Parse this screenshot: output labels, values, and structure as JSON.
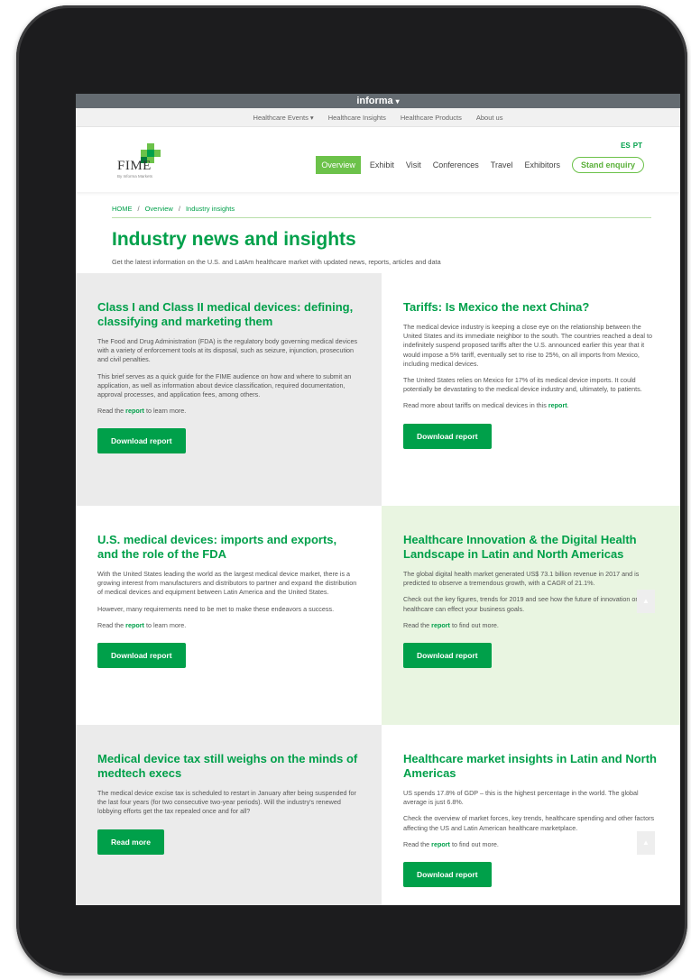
{
  "informa": {
    "label": "informa",
    "caret": "▾"
  },
  "top_nav": [
    "Healthcare Events ▾",
    "Healthcare Insights",
    "Healthcare Products",
    "About us"
  ],
  "logo": {
    "name": "FIME",
    "tagline": "By Informa Markets"
  },
  "lang": [
    "ES",
    "PT"
  ],
  "main_nav": {
    "items": [
      "Overview",
      "Exhibit",
      "Visit",
      "Conferences",
      "Travel",
      "Exhibitors"
    ],
    "enquiry": "Stand enquiry"
  },
  "breadcrumb": [
    "HOME",
    "Overview",
    "Industry insights"
  ],
  "breadcrumb_sep": "/",
  "page": {
    "title": "Industry news and insights",
    "subtitle": "Get the latest information on the U.S. and LatAm healthcare market with updated news, reports, articles and data"
  },
  "cards": [
    {
      "title": "Class I and Class II medical devices: defining, classifying and marketing them",
      "paragraphs": [
        "The Food and Drug Administration (FDA) is the regulatory body governing medical devices with a variety of enforcement tools at its disposal, such as seizure, injunction, prosecution and civil penalties.",
        "This brief serves as a quick guide for the FIME audience on how and where to submit an application, as well as information about device classification, required documentation, approval processes, and application fees, among others."
      ],
      "read_pre": "Read the ",
      "read_link": "report",
      "read_post": " to learn more.",
      "button": "Download report"
    },
    {
      "title": "Tariffs: Is Mexico the next China?",
      "paragraphs": [
        "The medical device industry is keeping a close eye on the relationship between the United States and its immediate neighbor to the south. The countries reached a deal to indefinitely suspend proposed tariffs after the U.S. announced earlier this year that it would impose a 5% tariff, eventually set to rise to 25%, on all imports from Mexico, including medical devices.",
        "The United States relies on Mexico for 17% of its medical device imports. It could potentially be devastating to the medical device industry and, ultimately, to patients."
      ],
      "read_pre": "Read more about tariffs on medical devices in this ",
      "read_link": "report",
      "read_post": ".",
      "button": "Download report"
    },
    {
      "title": "U.S. medical devices: imports and exports, and the role of the FDA",
      "paragraphs": [
        "With the United States leading the world as the largest medical device market, there is a growing interest from manufacturers and distributors to partner and expand the distribution of medical devices and equipment between Latin America and the United States.",
        "However, many requirements need to be met to make these endeavors a success."
      ],
      "read_pre": "Read the ",
      "read_link": "report",
      "read_post": " to learn more.",
      "button": "Download report"
    },
    {
      "title": "Healthcare Innovation & the Digital Health Landscape in Latin and North Americas",
      "paragraphs": [
        "The global digital health market generated US$ 73.1 billion revenue in 2017 and is predicted to observe a tremendous growth, with a CAGR of 21.1%.",
        "Check out the key figures, trends for 2019 and see how the future of innovation on healthcare can effect your business goals."
      ],
      "read_pre": "Read the ",
      "read_link": "report",
      "read_post": " to find out more.",
      "button": "Download report"
    },
    {
      "title": "Medical device tax still weighs on the minds of medtech execs",
      "paragraphs": [
        "The medical device excise tax is scheduled to restart in January after being suspended for the last four years (for two consecutive two-year periods). Will the industry's renewed lobbying efforts get the tax repealed once and for all?"
      ],
      "read_pre": "",
      "read_link": "",
      "read_post": "",
      "button": "Read more"
    },
    {
      "title": "Healthcare market insights in Latin and North Americas",
      "paragraphs": [
        "US spends 17.8% of GDP – this is the highest percentage in the world. The global average is just 6.8%.",
        "Check the overview of market forces, key trends, healthcare spending and other factors affecting the US and Latin American healthcare marketplace."
      ],
      "read_pre": "Read the ",
      "read_link": "report",
      "read_post": " to find out more.",
      "button": "Download report"
    }
  ],
  "scroll_top": {
    "icon": "arrow-up-icon",
    "glyph": "▲"
  },
  "colors": {
    "brand_green": "#00a04a",
    "nav_green": "#6cc24a",
    "card_grey": "#ebebeb",
    "card_light_green": "#e9f5e1",
    "informa_bar": "#646b71"
  }
}
